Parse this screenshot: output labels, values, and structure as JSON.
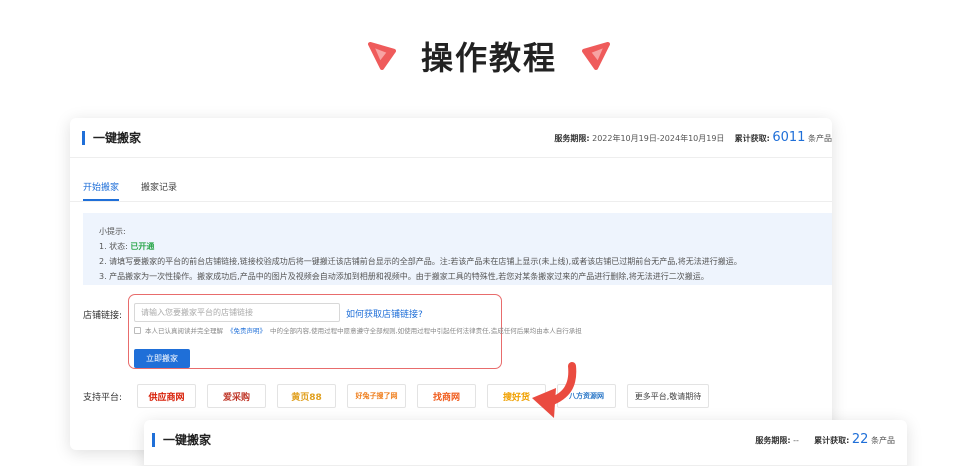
{
  "hero": {
    "title": "操作教程",
    "accent_color": "#ef5b5b"
  },
  "panel": {
    "title": "一键搬家",
    "service_label": "服务期限:",
    "service_period": "2022年10月19日-2024年10月19日",
    "acquired_label": "累计获取:",
    "acquired_count": "6011",
    "acquired_unit": "条产品",
    "tabs": [
      "开始搬家",
      "搬家记录"
    ],
    "active_tab": "开始搬家",
    "tips": {
      "title": "小提示:",
      "line1_prefix": "1. 状态:",
      "line1_status": "已开通",
      "line2": "2. 请填写要搬家的平台的前台店铺链接,链接校验成功后将一键搬迁该店铺前台显示的全部产品。注:若该产品未在店铺上显示(未上线),或者该店铺已过期前台无产品,将无法进行搬运。",
      "line3": "3. 产品搬家为一次性操作。搬家成功后,产品中的图片及视频会自动添加到相册和视频中。由于搬家工具的特殊性,若您对某条搬家过来的产品进行删除,将无法进行二次搬运。"
    },
    "store_label": "店铺链接:",
    "url_placeholder": "请输入您要搬家平台的店铺链接",
    "url_value": "",
    "howto_link": "如何获取店铺链接?",
    "agree_prefix": "本人已认真阅读并完全理解",
    "agree_link": "《免责声明》",
    "agree_suffix": "中的全部内容,使用过程中愿意遵守全部规则,如使用过程中引起任何法律责任,造成任何后果均由本人自行承担",
    "move_button": "立即搬家",
    "platform_label": "支持平台:",
    "platforms": [
      {
        "name": "供应商网",
        "color": "#d81e06"
      },
      {
        "name": "爱采购",
        "color": "#c0392b"
      },
      {
        "name": "黄页88",
        "color": "#e0a020"
      },
      {
        "name": "好兔子搜了网",
        "color": "#ef7d1a"
      },
      {
        "name": "找商网",
        "color": "#f05a1a"
      },
      {
        "name": "搜好货",
        "color": "#f0a000"
      },
      {
        "name": "八方资源网",
        "color": "#2c78c8"
      }
    ],
    "more_platforms": "更多平台,敬请期待"
  },
  "panel2": {
    "title": "一键搬家",
    "service_label": "服务期限:",
    "service_period": "--",
    "acquired_label": "累计获取:",
    "acquired_count": "22",
    "acquired_unit": "条产品"
  }
}
